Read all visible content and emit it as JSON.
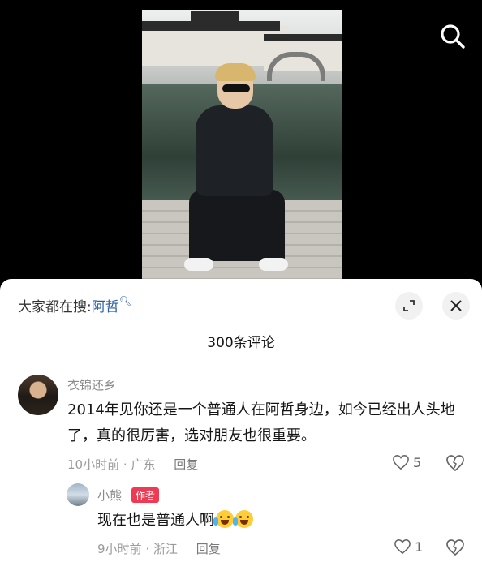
{
  "hot_search": {
    "prefix": "大家都在搜:",
    "keyword": "阿哲"
  },
  "comments_header": {
    "count_label": "300条评论"
  },
  "comments": [
    {
      "username": "衣锦还乡",
      "text": "2014年见你还是一个普通人在阿哲身边，如今已经出人头地了，真的很厉害，选对朋友也很重要。",
      "time": "10小时前",
      "location": "广东",
      "reply_label": "回复",
      "likes": "5"
    },
    {
      "username": "小熊",
      "badge": "作者",
      "text": "现在也是普通人啊",
      "time": "9小时前",
      "location": "浙江",
      "reply_label": "回复",
      "likes": "1"
    }
  ],
  "separator": "·",
  "icons": {
    "search": "search-icon",
    "expand": "expand-icon",
    "close": "close-icon",
    "like": "heart-icon",
    "dislike": "broken-heart-icon",
    "emoji": "crying-laughing-emoji"
  },
  "colors": {
    "keyword": "#2a5ca8",
    "author_badge": "#ee3a52"
  }
}
